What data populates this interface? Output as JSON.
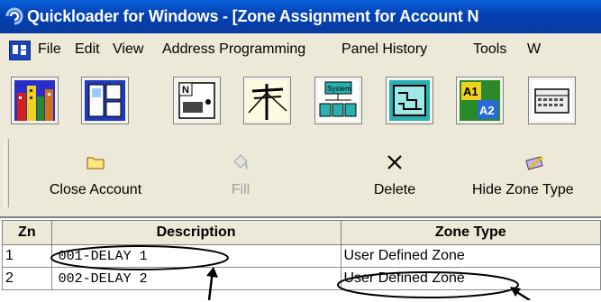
{
  "window": {
    "title": "Quickloader for Windows - [Zone Assignment for Account N"
  },
  "menu": {
    "items": [
      "File",
      "Edit",
      "View",
      "Address Programming",
      "Panel History",
      "Tools",
      "W"
    ]
  },
  "toolbar_icons": [
    "city-icon",
    "layout-icon",
    "panel-icon",
    "power-pole-icon",
    "system-icon",
    "circuit-icon",
    "a1-a2-icon",
    "keyboard-icon"
  ],
  "toolbar_text": {
    "panel": "N",
    "system": "System",
    "a1": "A1",
    "a2": "A2"
  },
  "actions": {
    "close_account": "Close Account",
    "fill": "Fill",
    "delete": "Delete",
    "hide_zone_type": "Hide Zone Type"
  },
  "grid": {
    "headers": {
      "zn": "Zn",
      "description": "Description",
      "zone_type": "Zone Type"
    },
    "rows": [
      {
        "zn": "1",
        "description": "001-DELAY 1",
        "zone_type": "User Defined Zone"
      },
      {
        "zn": "2",
        "description": "002-DELAY 2",
        "zone_type": "User Defined Zone"
      }
    ]
  },
  "colors": {
    "title_bar": "#0a4fc8",
    "menu_bg": "#ece9d8",
    "annotation": "#000000"
  }
}
